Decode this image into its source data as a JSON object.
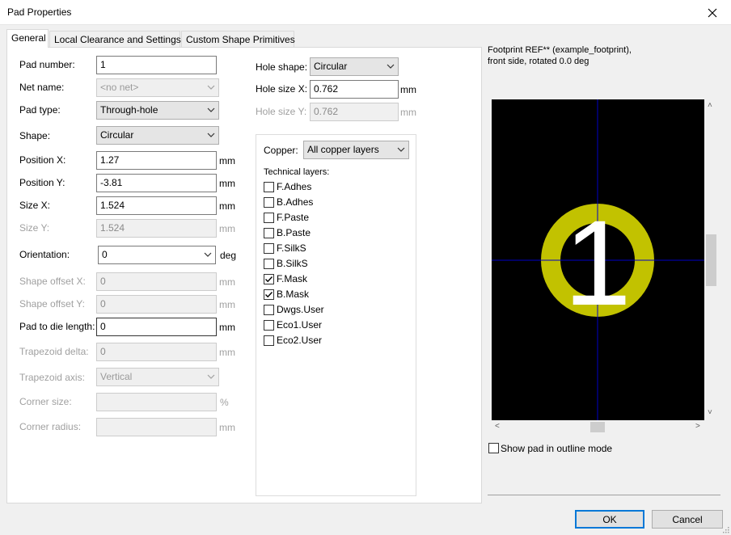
{
  "window": {
    "title": "Pad Properties",
    "close_icon": "close-icon"
  },
  "tabs": [
    "General",
    "Local Clearance and Settings",
    "Custom Shape Primitives"
  ],
  "left": {
    "pad_number_label": "Pad number:",
    "pad_number_value": "1",
    "net_name_label": "Net name:",
    "net_name_value": "<no net>",
    "pad_type_label": "Pad type:",
    "pad_type_value": "Through-hole",
    "shape_label": "Shape:",
    "shape_value": "Circular",
    "position_x_label": "Position X:",
    "position_x_value": "1.27",
    "position_y_label": "Position Y:",
    "position_y_value": "-3.81",
    "size_x_label": "Size X:",
    "size_x_value": "1.524",
    "size_y_label": "Size Y:",
    "size_y_value": "1.524",
    "orientation_label": "Orientation:",
    "orientation_value": "0",
    "shape_offset_x_label": "Shape offset X:",
    "shape_offset_x_value": "0",
    "shape_offset_y_label": "Shape offset Y:",
    "shape_offset_y_value": "0",
    "pad_to_die_label": "Pad to die length:",
    "pad_to_die_value": "0",
    "trapezoid_delta_label": "Trapezoid delta:",
    "trapezoid_delta_value": "0",
    "trapezoid_axis_label": "Trapezoid axis:",
    "trapezoid_axis_value": "Vertical",
    "corner_size_label": "Corner size:",
    "corner_size_value": "",
    "corner_radius_label": "Corner radius:",
    "corner_radius_value": "",
    "unit_mm": "mm",
    "unit_deg": "deg",
    "unit_pct": "%"
  },
  "hole": {
    "shape_label": "Hole shape:",
    "shape_value": "Circular",
    "size_x_label": "Hole size X:",
    "size_x_value": "0.762",
    "size_y_label": "Hole size Y:",
    "size_y_value": "0.762"
  },
  "layers": {
    "copper_label": "Copper:",
    "copper_value": "All copper layers",
    "technical_label": "Technical layers:",
    "items": [
      {
        "label": "F.Adhes",
        "checked": false
      },
      {
        "label": "B.Adhes",
        "checked": false
      },
      {
        "label": "F.Paste",
        "checked": false
      },
      {
        "label": "B.Paste",
        "checked": false
      },
      {
        "label": "F.SilkS",
        "checked": false
      },
      {
        "label": "B.SilkS",
        "checked": false
      },
      {
        "label": "F.Mask",
        "checked": true
      },
      {
        "label": "B.Mask",
        "checked": true
      },
      {
        "label": "Dwgs.User",
        "checked": false
      },
      {
        "label": "Eco1.User",
        "checked": false
      },
      {
        "label": "Eco2.User",
        "checked": false
      }
    ]
  },
  "preview": {
    "info_line1": "Footprint REF** (example_footprint),",
    "info_line2": "front side, rotated 0.0 deg",
    "pad_number": "1",
    "pad_color": "#c2c200",
    "crosshair_color": "#0000c8",
    "outline_mode_label": "Show pad in outline mode",
    "outline_mode_checked": false
  },
  "buttons": {
    "ok": "OK",
    "cancel": "Cancel"
  }
}
